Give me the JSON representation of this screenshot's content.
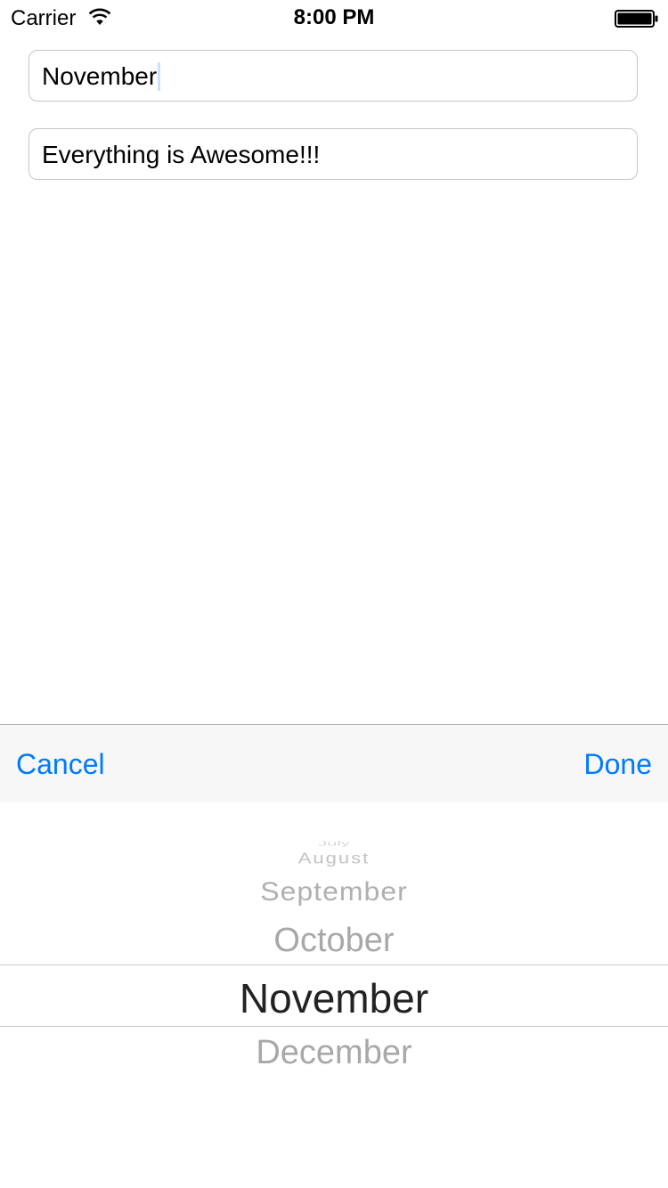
{
  "status_bar": {
    "carrier": "Carrier",
    "time": "8:00 PM"
  },
  "fields": {
    "month_value": "November",
    "message_value": "Everything is Awesome!!!"
  },
  "toolbar": {
    "cancel_label": "Cancel",
    "done_label": "Done",
    "accent_color": "#007aff"
  },
  "picker": {
    "rows": [
      "July",
      "August",
      "September",
      "October",
      "November",
      "December"
    ],
    "selected": "November"
  }
}
